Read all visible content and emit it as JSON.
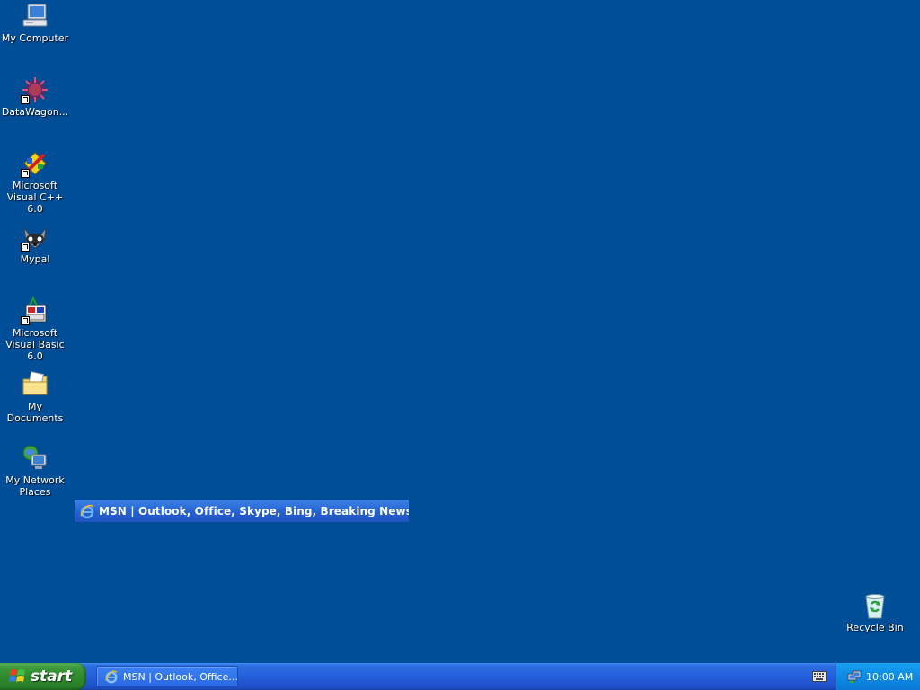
{
  "desktop": {
    "icons": [
      {
        "label": "My Computer",
        "icon": "my-computer-icon"
      },
      {
        "label": "DataWagon...",
        "icon": "datawagon-icon"
      },
      {
        "label": "Microsoft Visual C++ 6.0",
        "icon": "visual-cpp-icon"
      },
      {
        "label": "Mypal",
        "icon": "mypal-icon"
      },
      {
        "label": "Microsoft Visual Basic 6.0",
        "icon": "visual-basic-icon"
      },
      {
        "label": "My Documents",
        "icon": "my-documents-icon"
      },
      {
        "label": "My Network Places",
        "icon": "network-places-icon"
      },
      {
        "label": "Recycle Bin",
        "icon": "recycle-bin-icon"
      }
    ],
    "background_color": "#004e98"
  },
  "window_title_popup": {
    "text": "MSN | Outlook, Office, Skype, Bing, Breaking News, and"
  },
  "taskbar": {
    "start_label": "start",
    "items": [
      {
        "label": "MSN | Outlook, Office..."
      }
    ],
    "clock": "10:00 AM"
  }
}
